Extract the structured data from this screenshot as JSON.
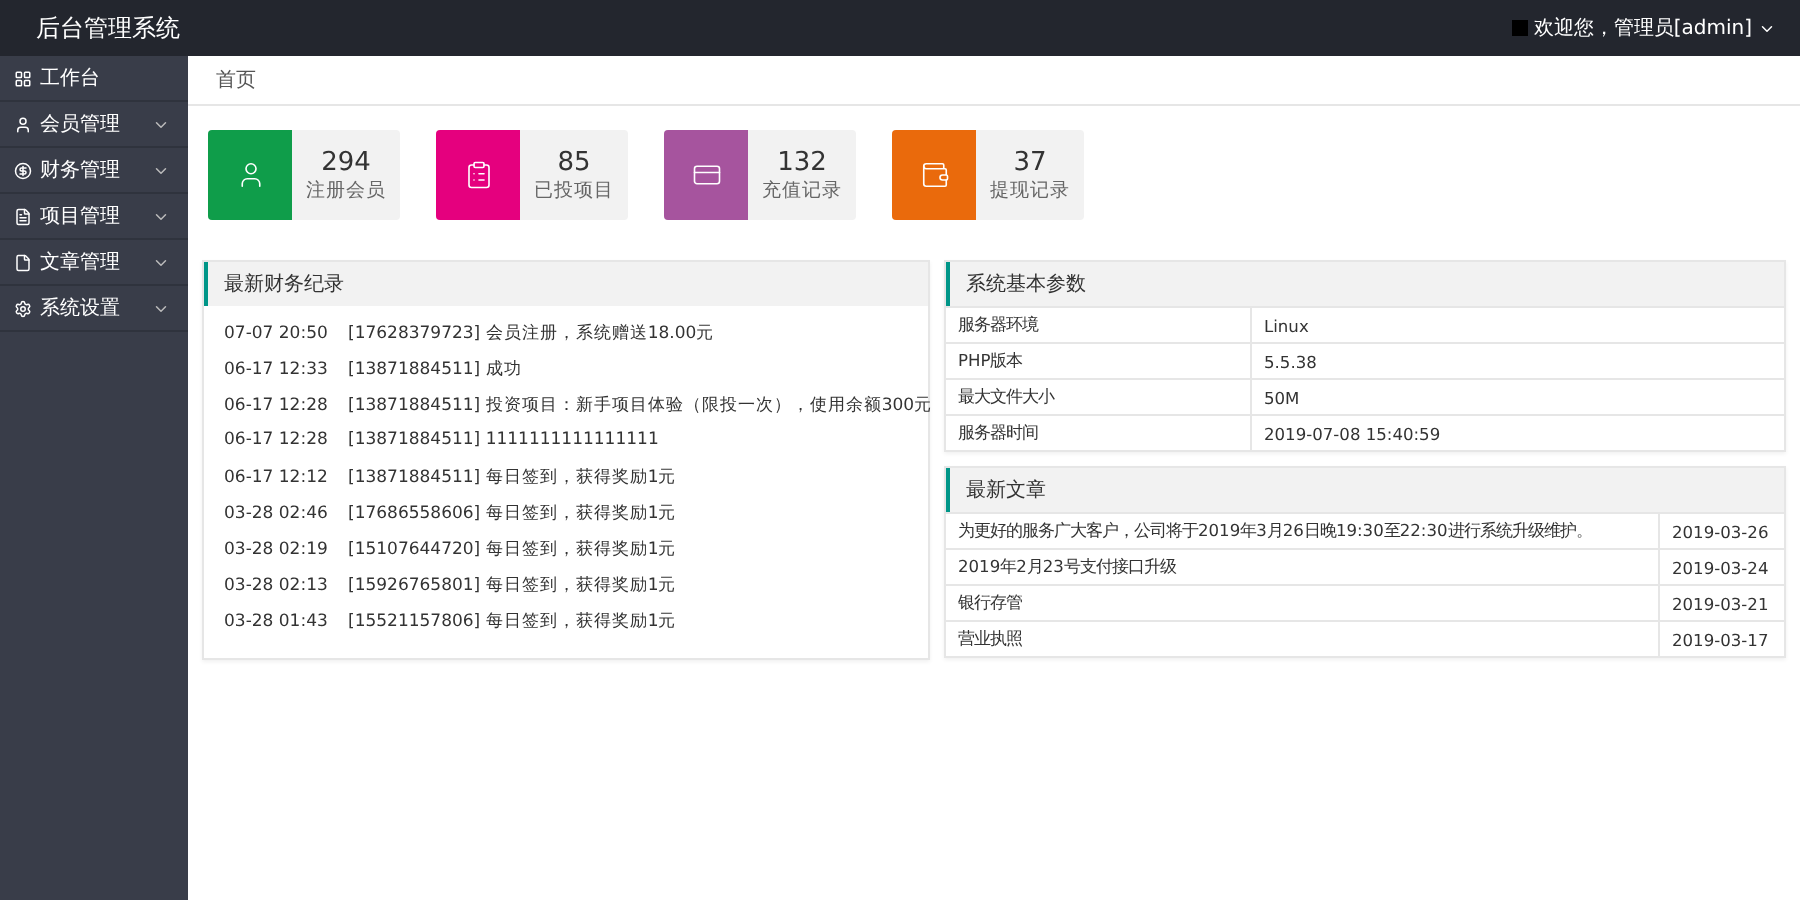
{
  "header": {
    "title": "后台管理系统",
    "user": "欢迎您，管理员[admin]"
  },
  "sidebar": {
    "items": [
      {
        "label": "工作台",
        "expandable": false
      },
      {
        "label": "会员管理",
        "expandable": true
      },
      {
        "label": "财务管理",
        "expandable": true
      },
      {
        "label": "项目管理",
        "expandable": true
      },
      {
        "label": "文章管理",
        "expandable": true
      },
      {
        "label": "系统设置",
        "expandable": true
      }
    ]
  },
  "breadcrumb": "首页",
  "stats": [
    {
      "value": "294",
      "label": "注册会员",
      "color": "#0f9d4a"
    },
    {
      "value": "85",
      "label": "已投项目",
      "color": "#e5007e"
    },
    {
      "value": "132",
      "label": "充值记录",
      "color": "#a6549e"
    },
    {
      "value": "37",
      "label": "提现记录",
      "color": "#ea6a0c"
    }
  ],
  "finance": {
    "title": "最新财务纪录",
    "rows": [
      {
        "time": "07-07 20:50",
        "text": "[17628379723] 会员注册，系统赠送18.00元"
      },
      {
        "time": "06-17 12:33",
        "text": "[13871884511] 成功"
      },
      {
        "time": "06-17 12:28",
        "text": "[13871884511] 投资项目：新手项目体验（限投一次），使用余额300元"
      },
      {
        "time": "06-17 12:28",
        "text": "[13871884511] 1111111111111111"
      },
      {
        "time": "06-17 12:12",
        "text": "[13871884511] 每日签到，获得奖励1元"
      },
      {
        "time": "03-28 02:46",
        "text": "[17686558606] 每日签到，获得奖励1元"
      },
      {
        "time": "03-28 02:19",
        "text": "[15107644720] 每日签到，获得奖励1元"
      },
      {
        "time": "03-28 02:13",
        "text": "[15926765801] 每日签到，获得奖励1元"
      },
      {
        "time": "03-28 01:43",
        "text": "[15521157806] 每日签到，获得奖励1元"
      }
    ]
  },
  "system": {
    "title": "系统基本参数",
    "rows": [
      {
        "name": "服务器环境",
        "value": "Linux"
      },
      {
        "name": "PHP版本",
        "value": "5.5.38"
      },
      {
        "name": "最大文件大小",
        "value": "50M"
      },
      {
        "name": "服务器时间",
        "value": "2019-07-08 15:40:59"
      }
    ]
  },
  "articles": {
    "title": "最新文章",
    "rows": [
      {
        "title": "为更好的服务广大客户，公司将于2019年3月26日晚19:30至22:30进行系统升级维护。",
        "date": "2019-03-26"
      },
      {
        "title": "2019年2月23号支付接口升级",
        "date": "2019-03-24"
      },
      {
        "title": "银行存管",
        "date": "2019-03-21"
      },
      {
        "title": "营业执照",
        "date": "2019-03-17"
      }
    ]
  }
}
